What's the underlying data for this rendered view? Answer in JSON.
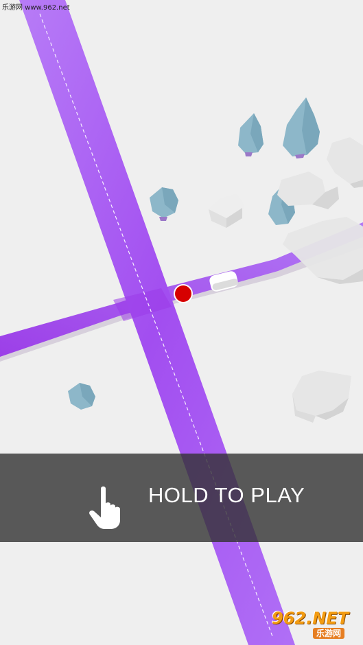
{
  "watermark": {
    "text": "乐游网 www.962.net"
  },
  "banner": {
    "label": "HOLD TO PLAY",
    "icon": "hand-pointer-icon"
  },
  "logo": {
    "line1": "962.NET",
    "line2": "乐游网"
  },
  "colors": {
    "background": "#efefef",
    "road": "#a95cf2",
    "road_dark": "#8f3fe0",
    "ball": "#d60000",
    "tree": "#8fb8c9",
    "rock": "#e6e6e6",
    "banner": "#3a3a3a"
  }
}
